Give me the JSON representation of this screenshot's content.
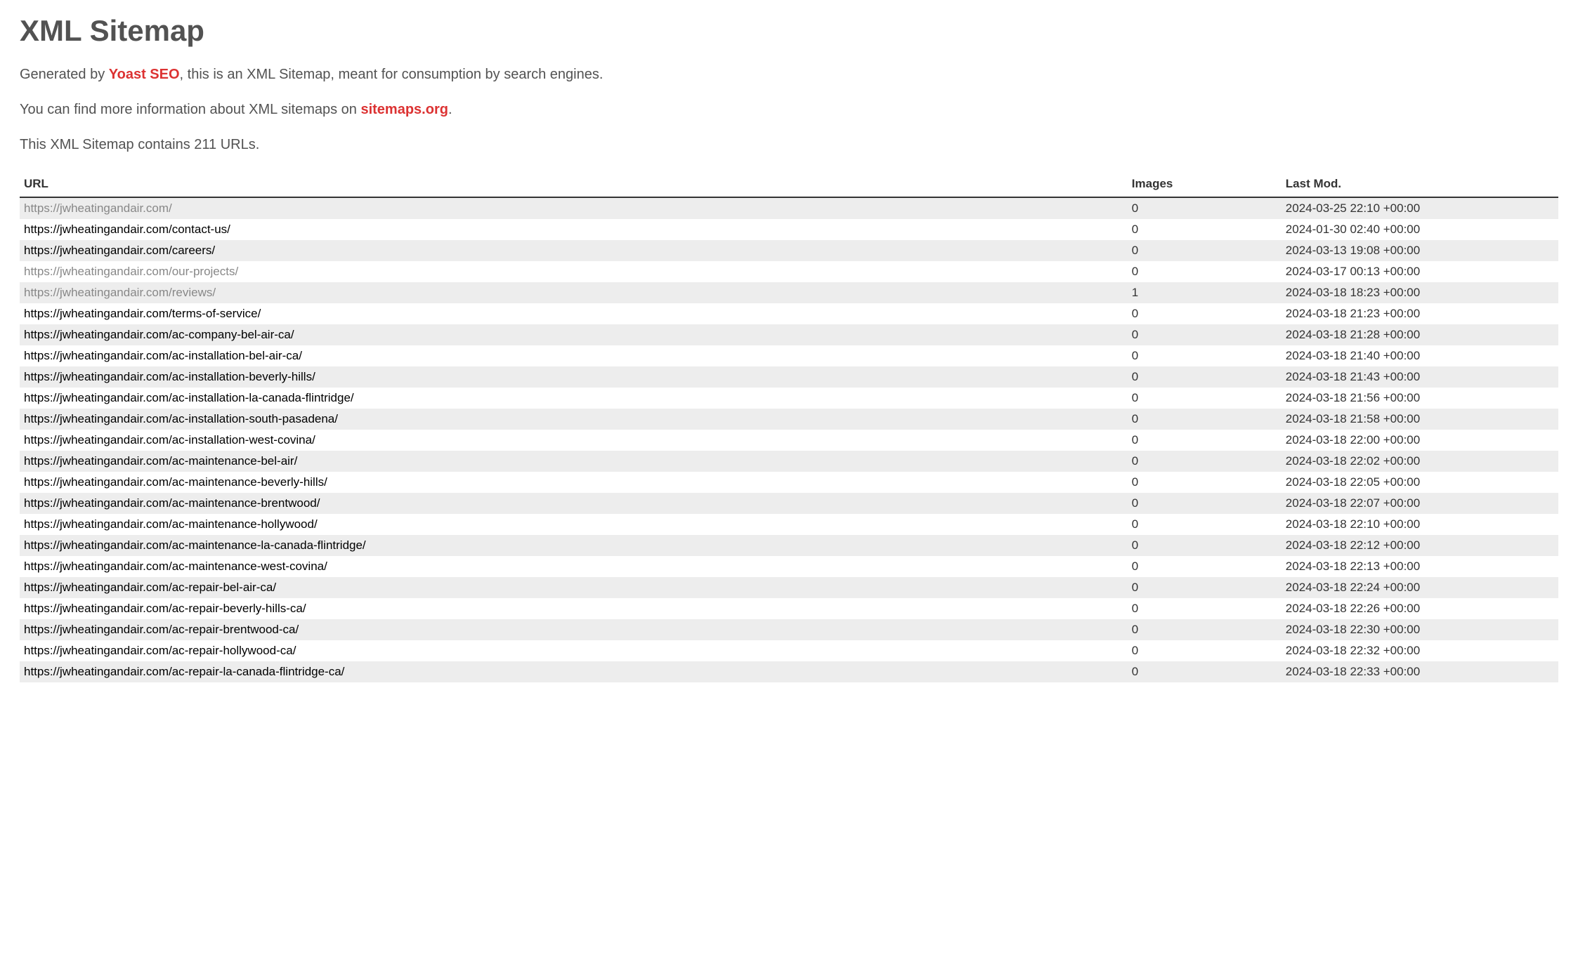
{
  "title": "XML Sitemap",
  "intro": {
    "generated_prefix": "Generated by ",
    "generated_link": "Yoast SEO",
    "generated_suffix": ", this is an XML Sitemap, meant for consumption by search engines.",
    "moreinfo_prefix": "You can find more information about XML sitemaps on ",
    "moreinfo_link": "sitemaps.org",
    "moreinfo_suffix": ".",
    "count_line": "This XML Sitemap contains 211 URLs."
  },
  "columns": {
    "url": "URL",
    "images": "Images",
    "lastmod": "Last Mod."
  },
  "rows": [
    {
      "url": "https://jwheatingandair.com/",
      "images": "0",
      "lastmod": "2024-03-25 22:10 +00:00",
      "visited": true
    },
    {
      "url": "https://jwheatingandair.com/contact-us/",
      "images": "0",
      "lastmod": "2024-01-30 02:40 +00:00",
      "visited": false
    },
    {
      "url": "https://jwheatingandair.com/careers/",
      "images": "0",
      "lastmod": "2024-03-13 19:08 +00:00",
      "visited": false
    },
    {
      "url": "https://jwheatingandair.com/our-projects/",
      "images": "0",
      "lastmod": "2024-03-17 00:13 +00:00",
      "visited": true
    },
    {
      "url": "https://jwheatingandair.com/reviews/",
      "images": "1",
      "lastmod": "2024-03-18 18:23 +00:00",
      "visited": true
    },
    {
      "url": "https://jwheatingandair.com/terms-of-service/",
      "images": "0",
      "lastmod": "2024-03-18 21:23 +00:00",
      "visited": false
    },
    {
      "url": "https://jwheatingandair.com/ac-company-bel-air-ca/",
      "images": "0",
      "lastmod": "2024-03-18 21:28 +00:00",
      "visited": false
    },
    {
      "url": "https://jwheatingandair.com/ac-installation-bel-air-ca/",
      "images": "0",
      "lastmod": "2024-03-18 21:40 +00:00",
      "visited": false
    },
    {
      "url": "https://jwheatingandair.com/ac-installation-beverly-hills/",
      "images": "0",
      "lastmod": "2024-03-18 21:43 +00:00",
      "visited": false
    },
    {
      "url": "https://jwheatingandair.com/ac-installation-la-canada-flintridge/",
      "images": "0",
      "lastmod": "2024-03-18 21:56 +00:00",
      "visited": false
    },
    {
      "url": "https://jwheatingandair.com/ac-installation-south-pasadena/",
      "images": "0",
      "lastmod": "2024-03-18 21:58 +00:00",
      "visited": false
    },
    {
      "url": "https://jwheatingandair.com/ac-installation-west-covina/",
      "images": "0",
      "lastmod": "2024-03-18 22:00 +00:00",
      "visited": false
    },
    {
      "url": "https://jwheatingandair.com/ac-maintenance-bel-air/",
      "images": "0",
      "lastmod": "2024-03-18 22:02 +00:00",
      "visited": false
    },
    {
      "url": "https://jwheatingandair.com/ac-maintenance-beverly-hills/",
      "images": "0",
      "lastmod": "2024-03-18 22:05 +00:00",
      "visited": false
    },
    {
      "url": "https://jwheatingandair.com/ac-maintenance-brentwood/",
      "images": "0",
      "lastmod": "2024-03-18 22:07 +00:00",
      "visited": false
    },
    {
      "url": "https://jwheatingandair.com/ac-maintenance-hollywood/",
      "images": "0",
      "lastmod": "2024-03-18 22:10 +00:00",
      "visited": false
    },
    {
      "url": "https://jwheatingandair.com/ac-maintenance-la-canada-flintridge/",
      "images": "0",
      "lastmod": "2024-03-18 22:12 +00:00",
      "visited": false
    },
    {
      "url": "https://jwheatingandair.com/ac-maintenance-west-covina/",
      "images": "0",
      "lastmod": "2024-03-18 22:13 +00:00",
      "visited": false
    },
    {
      "url": "https://jwheatingandair.com/ac-repair-bel-air-ca/",
      "images": "0",
      "lastmod": "2024-03-18 22:24 +00:00",
      "visited": false
    },
    {
      "url": "https://jwheatingandair.com/ac-repair-beverly-hills-ca/",
      "images": "0",
      "lastmod": "2024-03-18 22:26 +00:00",
      "visited": false
    },
    {
      "url": "https://jwheatingandair.com/ac-repair-brentwood-ca/",
      "images": "0",
      "lastmod": "2024-03-18 22:30 +00:00",
      "visited": false
    },
    {
      "url": "https://jwheatingandair.com/ac-repair-hollywood-ca/",
      "images": "0",
      "lastmod": "2024-03-18 22:32 +00:00",
      "visited": false
    },
    {
      "url": "https://jwheatingandair.com/ac-repair-la-canada-flintridge-ca/",
      "images": "0",
      "lastmod": "2024-03-18 22:33 +00:00",
      "visited": false
    }
  ]
}
